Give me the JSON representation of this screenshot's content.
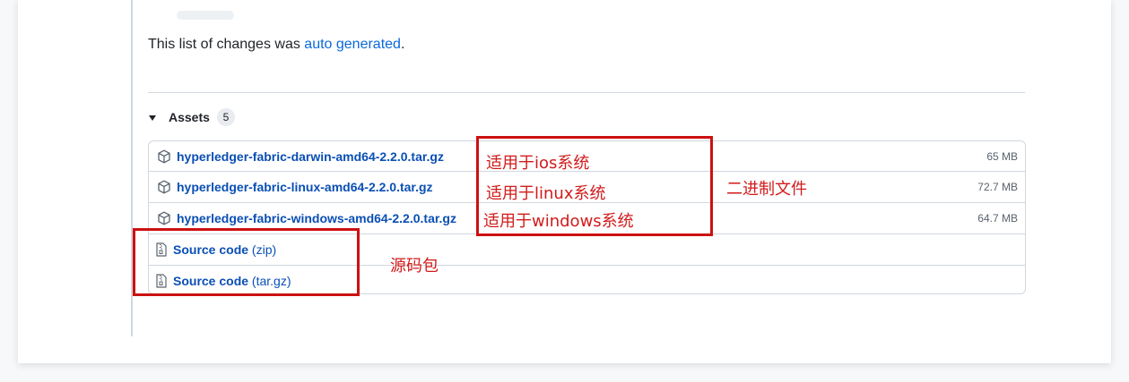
{
  "release": {
    "changes_prefix": "This list of changes was ",
    "changes_link": "auto generated",
    "changes_suffix": "."
  },
  "assets": {
    "title": "Assets",
    "count": "5",
    "files": [
      {
        "name": "hyperledger-fabric-darwin-amd64-2.2.0.tar.gz",
        "size": "65 MB",
        "icon": "package-icon"
      },
      {
        "name": "hyperledger-fabric-linux-amd64-2.2.0.tar.gz",
        "size": "72.7 MB",
        "icon": "package-icon"
      },
      {
        "name": "hyperledger-fabric-windows-amd64-2.2.0.tar.gz",
        "size": "64.7 MB",
        "icon": "package-icon"
      }
    ],
    "sources": [
      {
        "label": "Source code",
        "format": "(zip)",
        "icon": "file-zip-icon"
      },
      {
        "label": "Source code",
        "format": "(tar.gz)",
        "icon": "file-zip-icon"
      }
    ]
  },
  "annotations": {
    "ios": "适用于ios系统",
    "linux": "适用于linux系统",
    "windows": "适用于windows系统",
    "binary": "二进制文件",
    "source": "源码包",
    "color": "#cc1111"
  },
  "colors": {
    "link": "#0969da",
    "border": "#d0d7de",
    "annotation_red": "#cc1111"
  }
}
